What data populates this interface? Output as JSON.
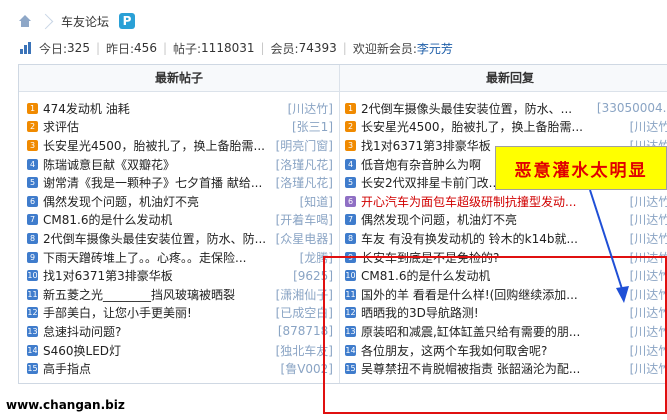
{
  "breadcrumb": {
    "title": "车友论坛",
    "logo": "P"
  },
  "stats": [
    {
      "label": "今日: ",
      "value": "325"
    },
    {
      "label": "昨日: ",
      "value": "456"
    },
    {
      "label": "帖子: ",
      "value": "1118031"
    },
    {
      "label": "会员: ",
      "value": "74393"
    }
  ],
  "welcome": {
    "label": "欢迎新会员: ",
    "name": "李元芳"
  },
  "columns": {
    "left": "最新帖子",
    "right": "最新回复"
  },
  "colors": {
    "num_orange": "#f08a00",
    "num_blue": "#3f7ccc",
    "num_purple": "#8f6fc4",
    "accent_red": "#d00000"
  },
  "left_posts": [
    {
      "n": "1",
      "title": "474发动机 油耗",
      "author": "[川达竹]"
    },
    {
      "n": "2",
      "title": "求评估",
      "author": "[张三1]"
    },
    {
      "n": "3",
      "title": "长安星光4500，胎被扎了，换上备胎需...",
      "author": "[明亮门窗]"
    },
    {
      "n": "4",
      "title": "陈瑞诚意巨献《双瓣花》",
      "author": "[洛瑾凡花]"
    },
    {
      "n": "5",
      "title": "谢常清《我是一颗种子》七夕首播 献给...",
      "author": "[洛瑾凡花]"
    },
    {
      "n": "6",
      "title": "偶然发现个问题，机油灯不亮",
      "author": "[知道]"
    },
    {
      "n": "7",
      "title": "CM81.6的是什么发动机",
      "author": "[开着车喝]"
    },
    {
      "n": "8",
      "title": "2代倒车摄像头最佳安装位置，防水、防...",
      "author": "[众星电器]"
    },
    {
      "n": "9",
      "title": "下雨天蹭砖堆上了。。心疼。。走保险...",
      "author": "[龙腾]"
    },
    {
      "n": "10",
      "title": "找1对6371第3排豪华板",
      "author": "[9625]"
    },
    {
      "n": "11",
      "title": "新五菱之光________挡风玻璃被晒裂",
      "author": "[潇湘仙子]"
    },
    {
      "n": "12",
      "title": "手部美白，让您小手更美丽!",
      "author": "[已成空白]"
    },
    {
      "n": "13",
      "title": "怠速抖动问题?",
      "author": "[878718]"
    },
    {
      "n": "14",
      "title": "S460换LED灯",
      "author": "[独北车友]"
    },
    {
      "n": "15",
      "title": "高手指点",
      "author": "[鲁V002]"
    }
  ],
  "right_posts": [
    {
      "n": "1",
      "title": "2代倒车摄像头最佳安装位置，防水、...",
      "author": "[33050004..]",
      "red": false
    },
    {
      "n": "2",
      "title": "长安星光4500，胎被扎了，换上备胎需...",
      "author": "[川达竹]",
      "red": false
    },
    {
      "n": "3",
      "title": "找1对6371第3排豪华板",
      "author": "[川达竹]",
      "red": false
    },
    {
      "n": "4",
      "title": "低音炮有杂音肿么为啊",
      "author": "[川达竹]",
      "red": false
    },
    {
      "n": "5",
      "title": "长安2代双排星卡前门改...",
      "author": "[川达竹]",
      "red": false
    },
    {
      "n": "6",
      "title": "开心汽车为面包车超级研制抗撞型发动...",
      "author": "[川达竹]",
      "red": true
    },
    {
      "n": "7",
      "title": "偶然发现个问题，机油灯不亮",
      "author": "[川达竹]",
      "red": false
    },
    {
      "n": "8",
      "title": "车友 有没有换发动机的 铃木的k14b就...",
      "author": "[川达竹]",
      "red": false
    },
    {
      "n": "9",
      "title": "长安车到底是不是免检的?",
      "author": "[川达竹]",
      "red": false
    },
    {
      "n": "10",
      "title": "CM81.6的是什么发动机",
      "author": "[川达竹]",
      "red": false
    },
    {
      "n": "11",
      "title": "国外的羊 看看是什么样!(回购继续添加...",
      "author": "[川达竹]",
      "red": false
    },
    {
      "n": "12",
      "title": "晒晒我的3D导航路测!",
      "author": "[川达竹]",
      "red": false
    },
    {
      "n": "13",
      "title": "原装昭和减震,缸体缸盖只给有需要的朋...",
      "author": "[川达竹]",
      "red": false
    },
    {
      "n": "14",
      "title": "各位朋友，这两个车我如何取舍呢?",
      "author": "[川达竹]",
      "red": false
    },
    {
      "n": "15",
      "title": "吴尊禁扭不肯脱帽被指责 张韶涵沦为配...",
      "author": "[川达竹]",
      "red": false
    }
  ],
  "annotation": {
    "callout": "恶意灌水太明显"
  },
  "watermark": "www.changan.biz"
}
